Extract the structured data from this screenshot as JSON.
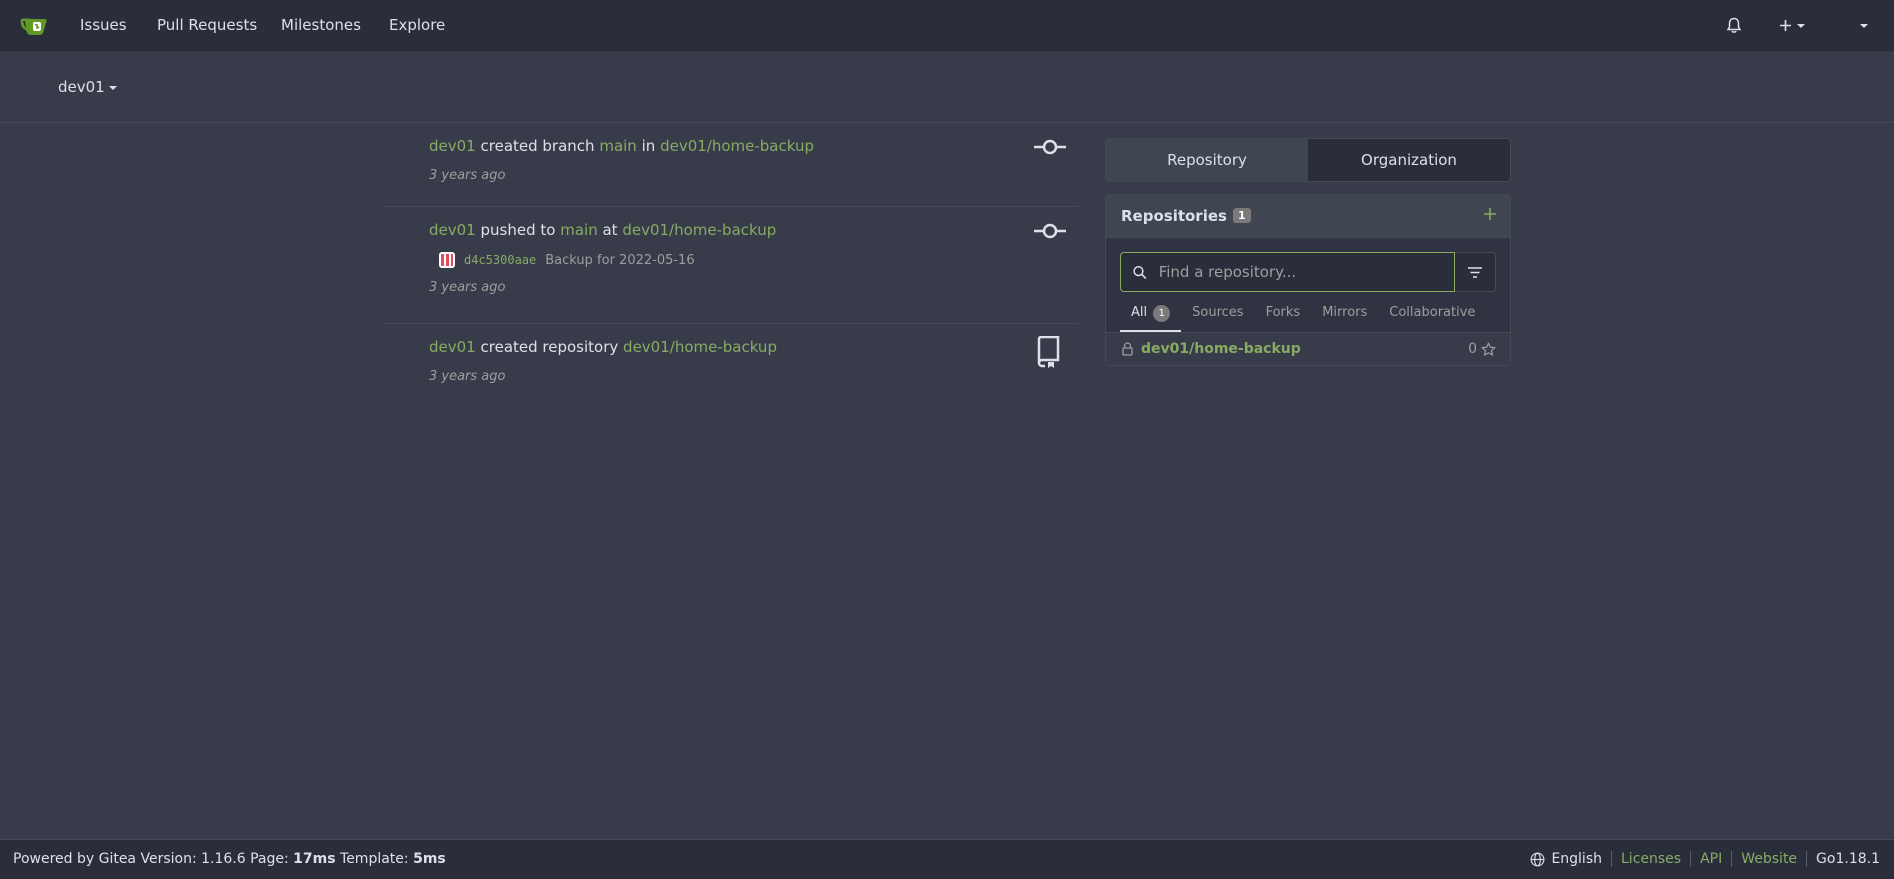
{
  "nav": {
    "items": [
      "Issues",
      "Pull Requests",
      "Milestones",
      "Explore"
    ]
  },
  "header": {
    "context_user": "dev01"
  },
  "feed": [
    {
      "user": "dev01",
      "action": "created branch",
      "ref": "main",
      "connector": "in",
      "repo": "dev01/home-backup",
      "time": "3 years ago",
      "icon": "git-commit-icon"
    },
    {
      "user": "dev01",
      "action": "pushed to",
      "ref": "main",
      "connector": "at",
      "repo": "dev01/home-backup",
      "commit_sha": "d4c5300aae",
      "commit_message": "Backup for 2022-05-16",
      "time": "3 years ago",
      "icon": "git-commit-icon"
    },
    {
      "user": "dev01",
      "action": "created repository",
      "repo": "dev01/home-backup",
      "time": "3 years ago",
      "icon": "repo-icon"
    }
  ],
  "panel": {
    "tabs": [
      "Repository",
      "Organization"
    ],
    "repositories_title": "Repositories",
    "repositories_count": "1",
    "search_placeholder": "Find a repository...",
    "type_tabs": [
      "All",
      "Sources",
      "Forks",
      "Mirrors",
      "Collaborative"
    ],
    "all_count": "1",
    "repos": [
      {
        "name": "dev01/home-backup",
        "stars": "0",
        "private": true
      }
    ]
  },
  "footer": {
    "powered_by": "Powered by Gitea Version: 1.16.6 Page:",
    "page_time": "17ms",
    "template_label": "Template:",
    "template_time": "5ms",
    "language": "English",
    "links": [
      "Licenses",
      "API",
      "Website"
    ],
    "go_version": "Go1.18.1"
  },
  "colors": {
    "background": "#383c4a",
    "navbar": "#2a2e3a",
    "accent": "#87ab63"
  }
}
